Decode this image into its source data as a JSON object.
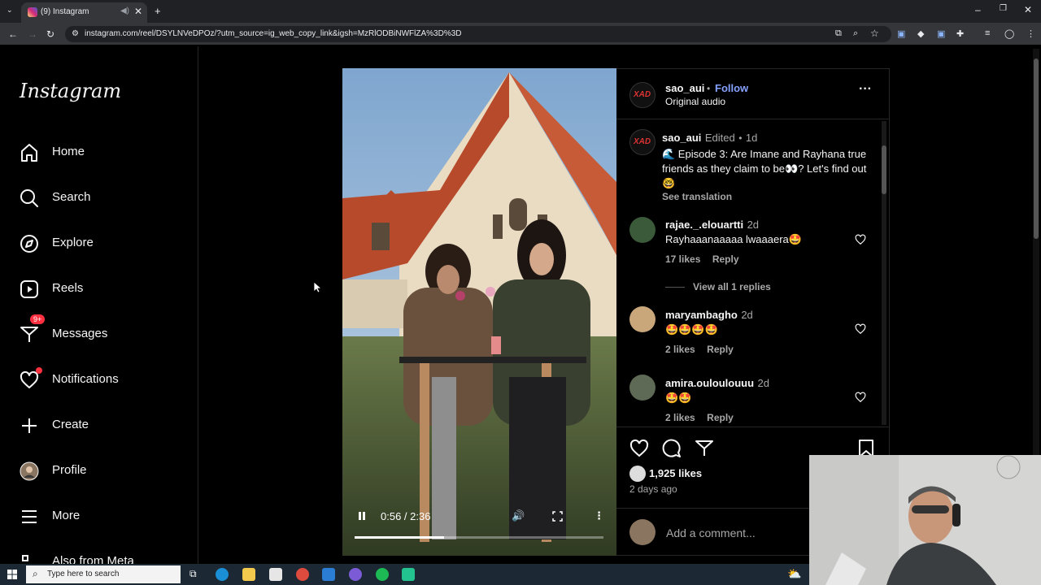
{
  "browser": {
    "tab_title": "(9) Instagram",
    "url": "instagram.com/reel/DSYLNVeDPOz/?utm_source=ig_web_copy_link&igsh=MzRlODBiNWFlZA%3D%3D"
  },
  "sidebar": {
    "logo": "Instagram",
    "items": [
      {
        "label": "Home",
        "icon": "home-icon"
      },
      {
        "label": "Search",
        "icon": "search-icon"
      },
      {
        "label": "Explore",
        "icon": "compass-icon"
      },
      {
        "label": "Reels",
        "icon": "reels-icon"
      },
      {
        "label": "Messages",
        "icon": "messenger-icon",
        "badge": "9+"
      },
      {
        "label": "Notifications",
        "icon": "heart-icon"
      },
      {
        "label": "Create",
        "icon": "plus-icon"
      },
      {
        "label": "Profile",
        "icon": "avatar-icon"
      },
      {
        "label": "More",
        "icon": "menu-icon"
      },
      {
        "label": "Also from Meta",
        "icon": "meta-icon"
      }
    ]
  },
  "video": {
    "time": "0:56 / 2:36",
    "progress": 0.36
  },
  "post": {
    "author": "sao_aui",
    "follow": "Follow",
    "audio": "Original audio",
    "caption": {
      "user": "sao_aui",
      "edited": "Edited",
      "age": "1d",
      "text": "🌊 Episode 3: Are Imane and Rayhana true friends as they claim to be👀? Let's find out 🤓",
      "translation": "See translation"
    },
    "comments": [
      {
        "user": "rajae._.elouartti",
        "age": "2d",
        "text": "Rayhaaanaaaaa lwaaaera🤩",
        "likes": "17 likes",
        "reply": "Reply",
        "view_replies": "View all 1 replies"
      },
      {
        "user": "maryambagho",
        "age": "2d",
        "text": "🤩🤩🤩🤩",
        "likes": "2 likes",
        "reply": "Reply"
      },
      {
        "user": "amira.ouloulouuu",
        "age": "2d",
        "text": "🤩🤩",
        "likes": "2 likes",
        "reply": "Reply"
      }
    ],
    "likes": "1,925 likes",
    "date": "2 days ago",
    "add_comment_placeholder": "Add a comment..."
  },
  "taskbar": {
    "search_placeholder": "Type here to search"
  },
  "colors": {
    "accent": "#85a1ff",
    "badge": "#ff3040",
    "background": "#000000"
  }
}
